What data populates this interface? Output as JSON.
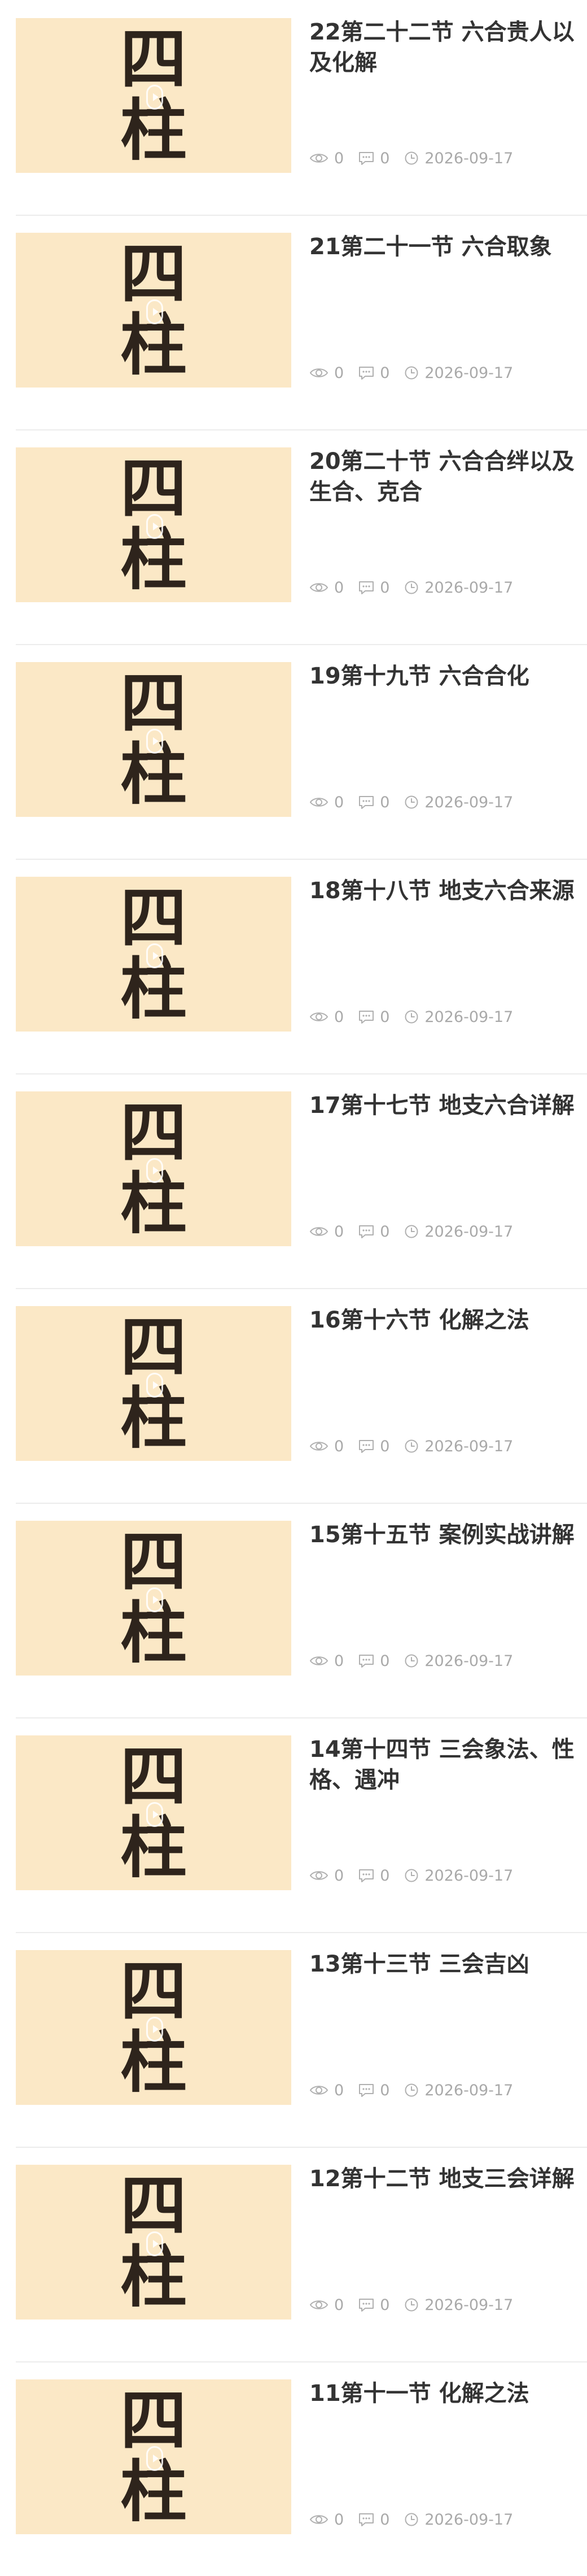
{
  "thumbnail": {
    "line1": "四",
    "line2": "柱"
  },
  "colors": {
    "thumb_bg": "#fbe8c6",
    "thumb_text": "#2e241c",
    "title": "#333333",
    "meta": "#a9a9a9",
    "divider": "#ececec"
  },
  "icons": [
    "eye-icon",
    "comment-icon",
    "clock-icon",
    "play-icon"
  ],
  "items": [
    {
      "title": "22第二十二节 六合贵人以及化解",
      "views": "0",
      "comments": "0",
      "date": "2026-09-17"
    },
    {
      "title": "21第二十一节 六合取象",
      "views": "0",
      "comments": "0",
      "date": "2026-09-17"
    },
    {
      "title": "20第二十节 六合合绊以及生合、克合",
      "views": "0",
      "comments": "0",
      "date": "2026-09-17"
    },
    {
      "title": "19第十九节 六合合化",
      "views": "0",
      "comments": "0",
      "date": "2026-09-17"
    },
    {
      "title": "18第十八节 地支六合来源",
      "views": "0",
      "comments": "0",
      "date": "2026-09-17"
    },
    {
      "title": "17第十七节 地支六合详解",
      "views": "0",
      "comments": "0",
      "date": "2026-09-17"
    },
    {
      "title": "16第十六节 化解之法",
      "views": "0",
      "comments": "0",
      "date": "2026-09-17"
    },
    {
      "title": "15第十五节 案例实战讲解",
      "views": "0",
      "comments": "0",
      "date": "2026-09-17"
    },
    {
      "title": "14第十四节 三会象法、性格、遇冲",
      "views": "0",
      "comments": "0",
      "date": "2026-09-17"
    },
    {
      "title": "13第十三节 三会吉凶",
      "views": "0",
      "comments": "0",
      "date": "2026-09-17"
    },
    {
      "title": "12第十二节 地支三会详解",
      "views": "0",
      "comments": "0",
      "date": "2026-09-17"
    },
    {
      "title": "11第十一节 化解之法",
      "views": "0",
      "comments": "0",
      "date": "2026-09-17"
    }
  ]
}
